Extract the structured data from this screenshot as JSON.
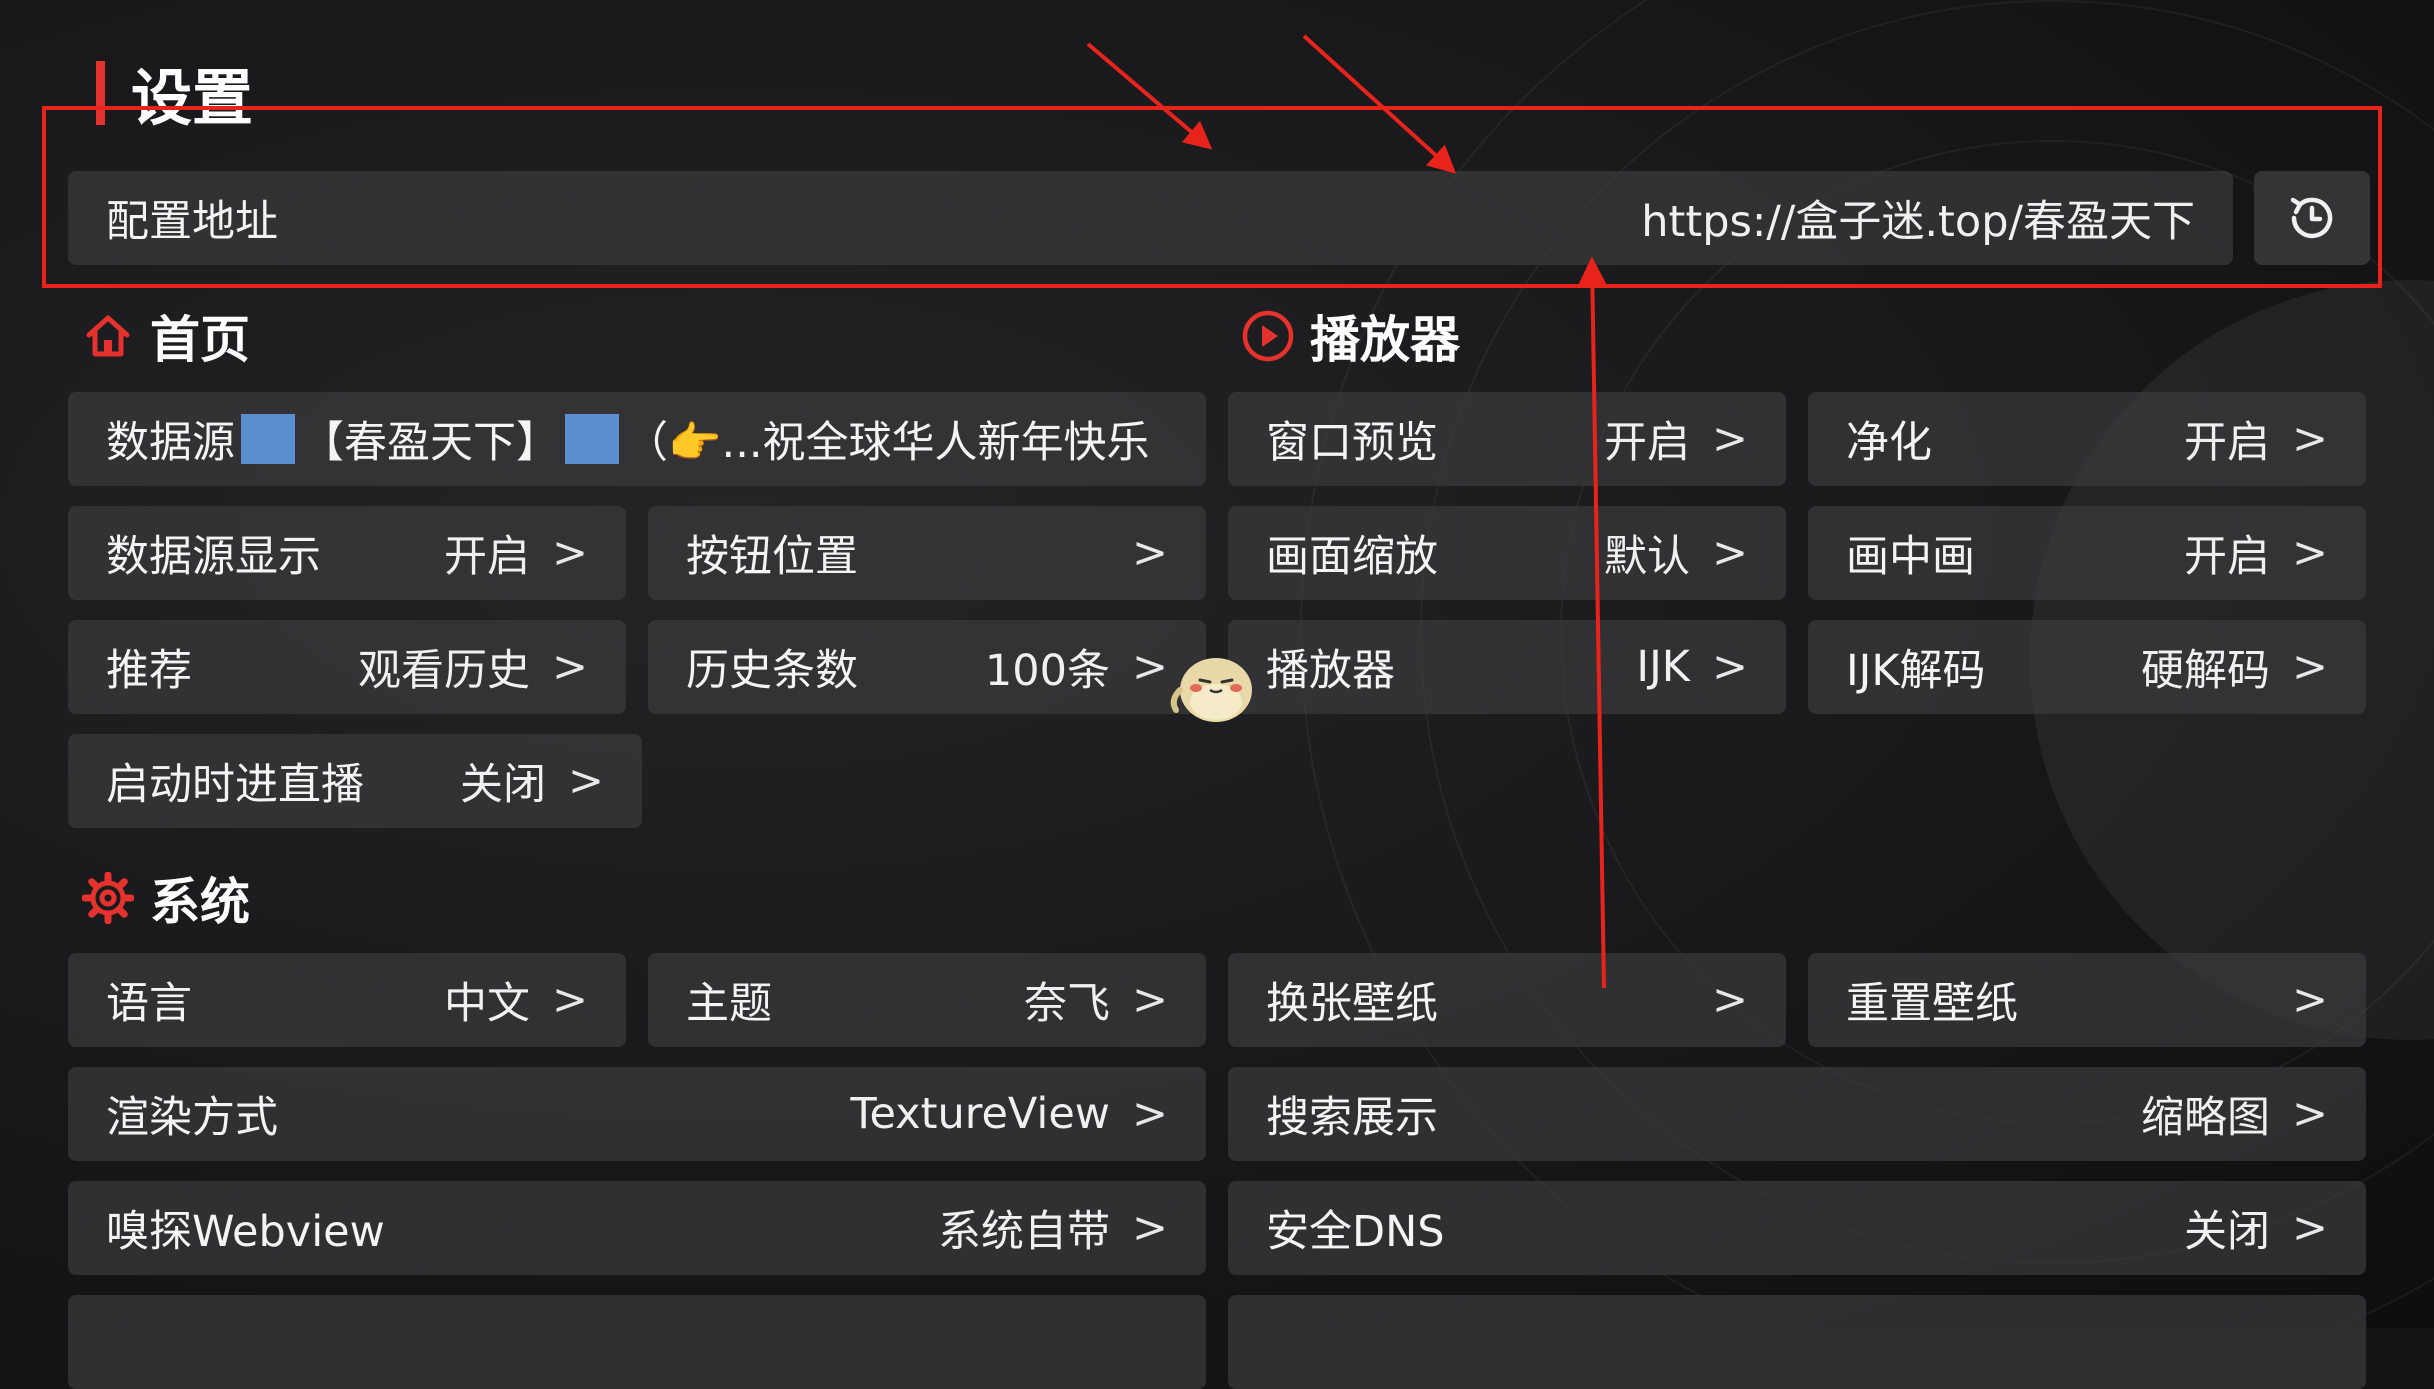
{
  "page": {
    "title": "设置"
  },
  "config": {
    "label": "配置地址",
    "url": "https://盒子迷.top/春盈天下",
    "history_icon": "history-icon"
  },
  "home": {
    "title": "首页",
    "icon": "home-icon",
    "source": {
      "label": "数据源",
      "name": "【春盈天下】",
      "tail": "（👉...祝全球华人新年快乐"
    },
    "source_display": {
      "label": "数据源显示",
      "value": "开启"
    },
    "button_position": {
      "label": "按钮位置",
      "value": ""
    },
    "recommend": {
      "label": "推荐",
      "value": "观看历史"
    },
    "history_count": {
      "label": "历史条数",
      "value": "100条"
    },
    "live_on_start": {
      "label": "启动时进直播",
      "value": "关闭"
    }
  },
  "player": {
    "title": "播放器",
    "icon": "play-circle-icon",
    "window_preview": {
      "label": "窗口预览",
      "value": "开启"
    },
    "purify": {
      "label": "净化",
      "value": "开启"
    },
    "scale": {
      "label": "画面缩放",
      "value": "默认"
    },
    "pip": {
      "label": "画中画",
      "value": "开启"
    },
    "player": {
      "label": "播放器",
      "value": "IJK"
    },
    "ijk_decode": {
      "label": "IJK解码",
      "value": "硬解码"
    }
  },
  "system": {
    "title": "系统",
    "icon": "gear-icon",
    "language": {
      "label": "语言",
      "value": "中文"
    },
    "theme": {
      "label": "主题",
      "value": "奈飞"
    },
    "change_wallpaper": {
      "label": "换张壁纸",
      "value": ""
    },
    "reset_wallpaper": {
      "label": "重置壁纸",
      "value": ""
    },
    "render": {
      "label": "渲染方式",
      "value": "TextureView"
    },
    "search_display": {
      "label": "搜索展示",
      "value": "缩略图"
    },
    "sniff_webview": {
      "label": "嗅探Webview",
      "value": "系统自带"
    },
    "secure_dns": {
      "label": "安全DNS",
      "value": "关闭"
    }
  },
  "arrow_symbol": ">",
  "colors": {
    "accent": "#e5322e",
    "annotation": "#e8231c",
    "item_bg": "#3a3a3c",
    "square": "#5b8fd0"
  }
}
